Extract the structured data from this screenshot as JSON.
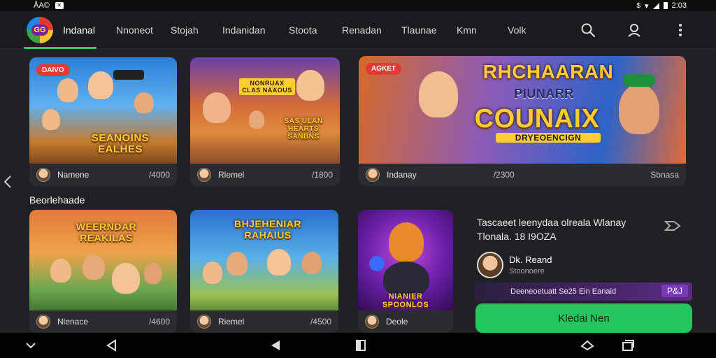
{
  "status_bar": {
    "left_text": "ÅA© ",
    "time": "2:03"
  },
  "logo": {
    "text": "GG"
  },
  "nav": {
    "items": [
      "Indanal",
      "Nnoneot",
      "Stojah",
      "Indanidan",
      "Stoota",
      "Renadan",
      "Tlaunae",
      "Kmn",
      "Volk"
    ],
    "active_index": 0
  },
  "icons": {
    "search": "search-icon",
    "profile": "user-icon",
    "more": "more-vertical-icon"
  },
  "top_row": [
    {
      "badge": "DAIVO",
      "art_title": "SEANOINS EALHES",
      "author": "Namene",
      "count": "/4000"
    },
    {
      "art_title": "NONRUAX CLAS NAAOUS",
      "art_title2": "SAS ULAN HEARTS SANBNS",
      "author": "Rlemel",
      "count": "/1800"
    },
    {
      "badge": "AGKET",
      "art_title": "RHCHAARAN",
      "art_sub": "PIUNARR",
      "art_big": "COUNAIX",
      "art_tag": "DRYEOENCIGN",
      "author": "Indanay",
      "count": "/2300",
      "count2": "Sbnasa"
    }
  ],
  "section": {
    "title": "Beorlehaade"
  },
  "bottom_row": [
    {
      "art_title": "WEERNDAR REAKILAS",
      "author": "Nlenace",
      "count": "/4600"
    },
    {
      "art_title": "BHJEHENIAR RAHAIUS",
      "author": "Riemel",
      "count": "/4500"
    },
    {
      "art_title": "NIANIER SPOONLOS",
      "author": "Deole"
    }
  ],
  "side": {
    "title": "Tascaeet leenydaa olreala Wlanay Tlonala. 18 I9OZA",
    "author_name": "Dk. Reand",
    "author_sub": "Stoonoere",
    "promo_text": "Deeneoetuatt Se25 Ein Eanaid",
    "promo_chip": "P&J",
    "cta_label": "Kledai Nen"
  },
  "colors": {
    "accent": "#22c55e",
    "badge": "#e53935",
    "background": "#1f2124"
  }
}
